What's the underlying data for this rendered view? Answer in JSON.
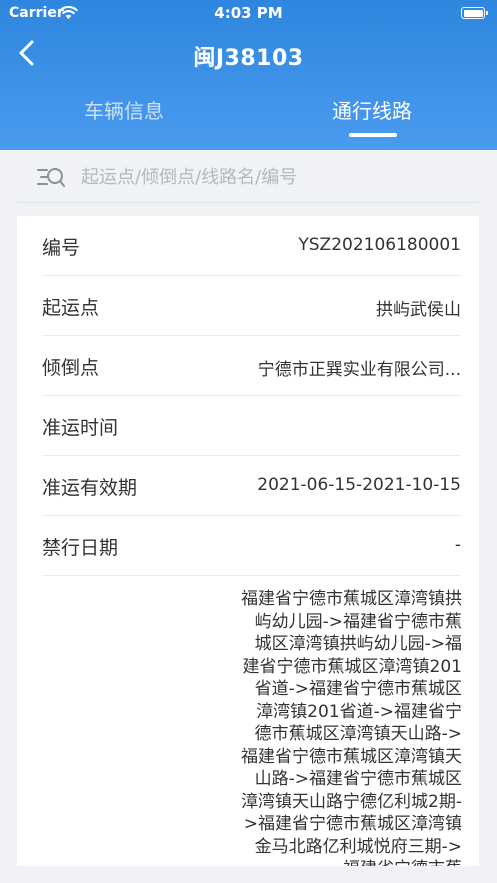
{
  "status_bar": {
    "carrier": "Carrier",
    "time": "4:03 PM",
    "icons": [
      "wifi-icon",
      "battery-icon"
    ]
  },
  "nav": {
    "title": "闽J38103",
    "back_icon": "chevron-left-icon"
  },
  "tabs": [
    {
      "label": "车辆信息",
      "active": false
    },
    {
      "label": "通行线路",
      "active": true
    }
  ],
  "search": {
    "placeholder": "起运点/倾倒点/线路名/编号",
    "value": "",
    "icon": "list-search-icon"
  },
  "details": [
    {
      "label": "编号",
      "value": "YSZ202106180001"
    },
    {
      "label": "起运点",
      "value": "拱屿武侯山"
    },
    {
      "label": "倾倒点",
      "value": "宁德市正巽实业有限公司..."
    },
    {
      "label": "准运时间",
      "value": ""
    },
    {
      "label": "准运有效期",
      "value": "2021-06-15-2021-10-15"
    },
    {
      "label": "禁行日期",
      "value": "-"
    }
  ],
  "route": "福建省宁德市蕉城区漳湾镇拱屿幼儿园->福建省宁德市蕉城区漳湾镇拱屿幼儿园->福建省宁德市蕉城区漳湾镇201省道->福建省宁德市蕉城区漳湾镇201省道->福建省宁德市蕉城区漳湾镇天山路->福建省宁德市蕉城区漳湾镇天山路->福建省宁德市蕉城区漳湾镇天山路宁德亿利城2期->福建省宁德市蕉城区漳湾镇金马北路亿利城悦府三期->福建省宁德市蕉",
  "colors": {
    "header_top": "#2e86de",
    "header_bottom": "#4a9bef",
    "background": "#f0f2f5",
    "card": "#ffffff"
  }
}
